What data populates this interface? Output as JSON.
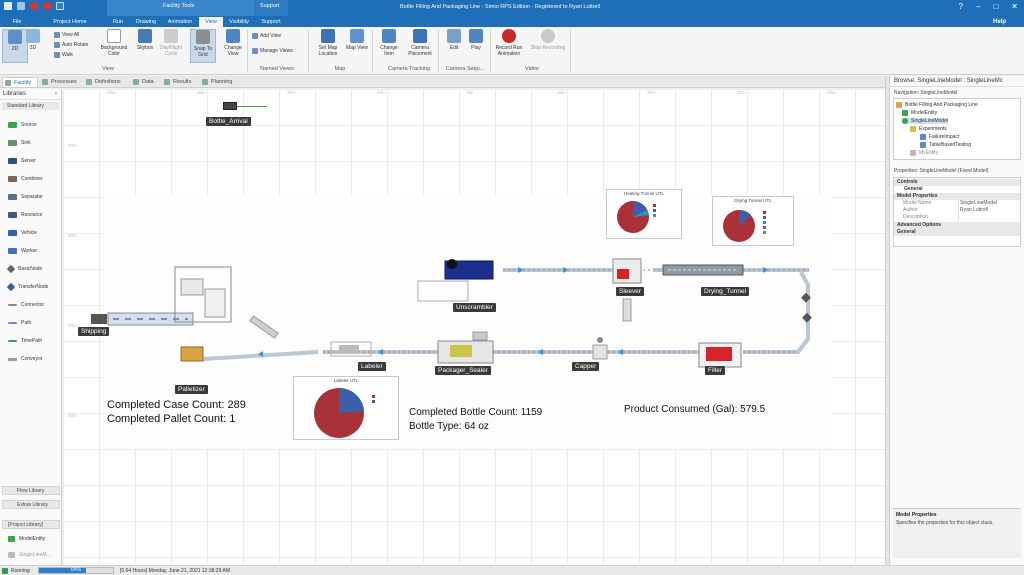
{
  "title_bar": {
    "window_title": "Bottle Filling And Packaging Line - Simio RPS Edition - Registered to Ryan Luttrell",
    "context_group": "Facility Tools",
    "support_group": "Support"
  },
  "tabs": {
    "file": "File",
    "project_home": "Project Home",
    "run": "Run",
    "drawing": "Drawing",
    "animation": "Animation",
    "view": "View",
    "visibility": "Visibility",
    "support": "Support",
    "help": "Help"
  },
  "ribbon": {
    "view_2d": "2D",
    "view_3d": "3D",
    "view_all": "View All",
    "auto_rotate": "Auto Rotate",
    "walk": "Walk",
    "background_color": "Background Color",
    "skybox": "Skybox",
    "day_night_cycle": "Day/Night Cycle",
    "snap_to_grid": "Snap To Grid",
    "change_view": "Change View",
    "add_view": "Add View",
    "manage_views": "Manage Views",
    "set_map_location": "Set Map Location",
    "map_view": "Map View",
    "change_item": "Change Item",
    "camera_placement": "Camera Placement",
    "edit": "Edit",
    "play": "Play",
    "record_run_animation": "Record Run Animation",
    "stop_recording": "Stop Recording",
    "group_view": "View",
    "group_named_views": "Named Views",
    "group_map": "Map",
    "group_camera_tracking": "Camera Tracking",
    "group_camera_sequences": "Camera Sequ...",
    "group_video": "Video"
  },
  "doc_tabs": [
    "Facility",
    "Processes",
    "Definitions",
    "Data",
    "Results",
    "Planning"
  ],
  "libraries": {
    "title": "Libraries",
    "section": "Standard Library",
    "items": [
      "Source",
      "Sink",
      "Server",
      "Combiner",
      "Separator",
      "Resource",
      "Vehicle",
      "Worker",
      "BasicNode",
      "TransferNode",
      "Connector",
      "Path",
      "TimePath",
      "Conveyor"
    ],
    "flow_library": "Flow Library",
    "extras_library": "Extras Library",
    "project_library": "[Project Library]",
    "project_items": [
      "ModelEntity",
      "SingleLineM..."
    ]
  },
  "canvas": {
    "ruler_marks": [
      "40m",
      "30m",
      "20m",
      "10m",
      "0m",
      "10m",
      "20m",
      "30m",
      "40m",
      "50m",
      "60m",
      "70m"
    ],
    "side_marks": [
      "10m",
      "20m",
      "30m",
      "40m"
    ],
    "object_labels": {
      "bottle_arrival": "Bottle_Arrival",
      "shipping": "Shipping",
      "palletizer": "Palletizer",
      "unscrambler": "Unscrambler",
      "labeler": "Labeler",
      "packager_sealer": "Packager_Sealer",
      "capper": "Capper",
      "sleever": "Sleever",
      "drying_tunnel": "Drying_Tunnel",
      "filler": "Filler"
    },
    "charts": {
      "heating": "Heating Tunnel UTL",
      "drying": "Drying Tunnel UTL",
      "labeler": "Labeler UTL"
    },
    "stats": {
      "case_count_label": "Completed Case Count:",
      "case_count": "289",
      "pallet_count_label": "Completed Pallet Count:",
      "pallet_count": "1",
      "bottle_count_label": "Completed Bottle Count:",
      "bottle_count": "1159",
      "bottle_type_label": "Bottle Type:",
      "bottle_type": "64 oz",
      "consumed_label": "Product Consumed (Gal):",
      "consumed": "579.5"
    },
    "colors": {
      "pie_red": "#a83237",
      "pie_blue": "#3b5fa8",
      "accent_blue": "#1e6fb8"
    }
  },
  "browse": {
    "title": "Browse: SingleLineModel : SingleLineMc",
    "navigation": "Navigation: SingleLineModel",
    "tree": [
      "Bottle Filling And Packaging Line",
      "ModelEntity",
      "SingleLineModel",
      "Experiments",
      "FailureImpact",
      "TableBasedTesting",
      "MyEntity"
    ],
    "properties_label": "Properties: SingleLineModel (Fixed Model)",
    "prop_rows": {
      "controls": "Controls",
      "general": "General",
      "model_properties": "Model Properties",
      "model_name_k": "Model Name",
      "model_name_v": "SingleLineModel",
      "author_k": "Author",
      "author_v": "Ryan Luttrell",
      "description_k": "Description",
      "advanced_options": "Advanced Options",
      "general2": "General"
    },
    "desc_title": "Model Properties",
    "desc_text": "Specifies the properties for this object class."
  },
  "status": {
    "state": "Running",
    "progress": "64%",
    "progress_fraction": 0.64,
    "time": "[0.64 Hours] Monday, June 21, 2021 12:38:29 AM"
  }
}
